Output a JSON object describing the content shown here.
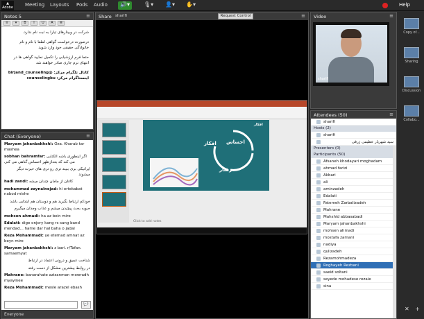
{
  "topbar": {
    "logo": "Adobe",
    "menus": [
      "Meeting",
      "Layouts",
      "Pods",
      "Audio"
    ],
    "help": "Help",
    "icons": [
      "speaker-icon",
      "webcam-icon",
      "mic-icon",
      "user-icon",
      "raise-hand-icon"
    ]
  },
  "notes": {
    "title": "Notes 5",
    "paragraphs": [
      "شرکت در وبینارهای تیارا به ثبت نام ندارد.",
      "درصورت درخواست گواهی لطفا با نام و نام خانوادگی حقیقی خود وارد شوید",
      "حتما فرم ارزشیابی را تکمیل نمایید گواهی ها در انتهای ترم جاری صادر خواهند شد"
    ],
    "social_1": "کانال تلگرام مرکز: @birjand_counseling",
    "social_2": "اینستاگرام مرکز: counselingbu"
  },
  "chat": {
    "title": "Chat",
    "scope": "(Everyone)",
    "messages": [
      {
        "sender": "Maryam jahanbakhshi:",
        "text": "Oza. Kharab tar mashea"
      },
      {
        "sender": "sobhan bahramfar:",
        "text": "اگر اینطوری باشه الکتابی می کنه که بعدازظهر احساس گناهی می کنی"
      },
      {
        "sender": "",
        "text": "ایرانیکی بری ببیند تری رو تری های حیرت دیگر میشوند",
        "rtl": true
      },
      {
        "sender": "hadi zandi:",
        "text": "کاغان از مامان چندان میشه"
      },
      {
        "sender": "mohammad zaynalnejad:",
        "text": "hi ertekabat nabod mishe"
      },
      {
        "sender": "",
        "text": "خودکم ارتباط بگیرید هم و دوستان هم ابتدایی باشد",
        "rtl": true
      },
      {
        "sender": "",
        "text": "حبوبه بحث پیچیدن میشم و عذاب وجدان میگیرم",
        "rtl": true
      },
      {
        "sender": "mohsen ahmadi:",
        "text": "ha az bein mire"
      },
      {
        "sender": "Edalati:",
        "text": "dige onjory kang rs sang band mendad... hame dar hal baha o jadal"
      },
      {
        "sender": "Reza Mohammadi:",
        "text": "ye etemad amnat az beyn mire"
      },
      {
        "sender": "Maryam jahanbakhshi:",
        "text": "z bari. r/Tafan. samaemyat"
      },
      {
        "sender": "",
        "text": "شناخت عمیق و درونی اعتماد در ارتباط",
        "rtl": true
      },
      {
        "sender": "",
        "text": "در روابط بیشترین مشکل از دست رفته",
        "rtl": true
      },
      {
        "sender": "Mahrane:",
        "text": "banarahate azizanman mowradh myayinee"
      },
      {
        "sender": "Reza Mohammadi:",
        "text": "mesle arazel ebash"
      }
    ],
    "tab": "Everyone"
  },
  "share": {
    "title": "Share",
    "presenter": "sharifi",
    "request_label": "Request Control",
    "slide_words": {
      "feeling": "احساس",
      "thoughts": "افکار",
      "behavior": "رفتار",
      "title": "افکار"
    },
    "notes_placeholder": "Click to add notes"
  },
  "video": {
    "title": "Video",
    "name": "sharifi"
  },
  "attendees": {
    "title": "Attendees",
    "count": "(50)",
    "me": "sharifi",
    "hosts_label": "Hosts (2)",
    "hosts": [
      "sharifi",
      "سید شهریار عظیمی ژرفی"
    ],
    "presenters_label": "Presenters (0)",
    "participants_label": "Participants (50)",
    "participants": [
      "Afsaneh khodayari moghadam",
      "ahmad farizi",
      "Akbari",
      "ali",
      "aminzadeh",
      "Edalati",
      "Fatemeh Zarbalizadeh",
      "Mahrane",
      "Mahshid abbasabadi",
      "Maryam jahanbakhshi",
      "mohsen ahmadi",
      "mostafa zamani",
      "nadiya",
      "qulizadeh",
      "Rezamohmadeza",
      "Roghayeh Rezbani",
      "saeid soltani",
      "seyede mohadese rezaie",
      "sina"
    ],
    "selected": "Roghayeh Rezbani"
  },
  "layouts": {
    "items": [
      "Copy of...",
      "Sharing",
      "Discussion",
      "Collabo..."
    ]
  }
}
